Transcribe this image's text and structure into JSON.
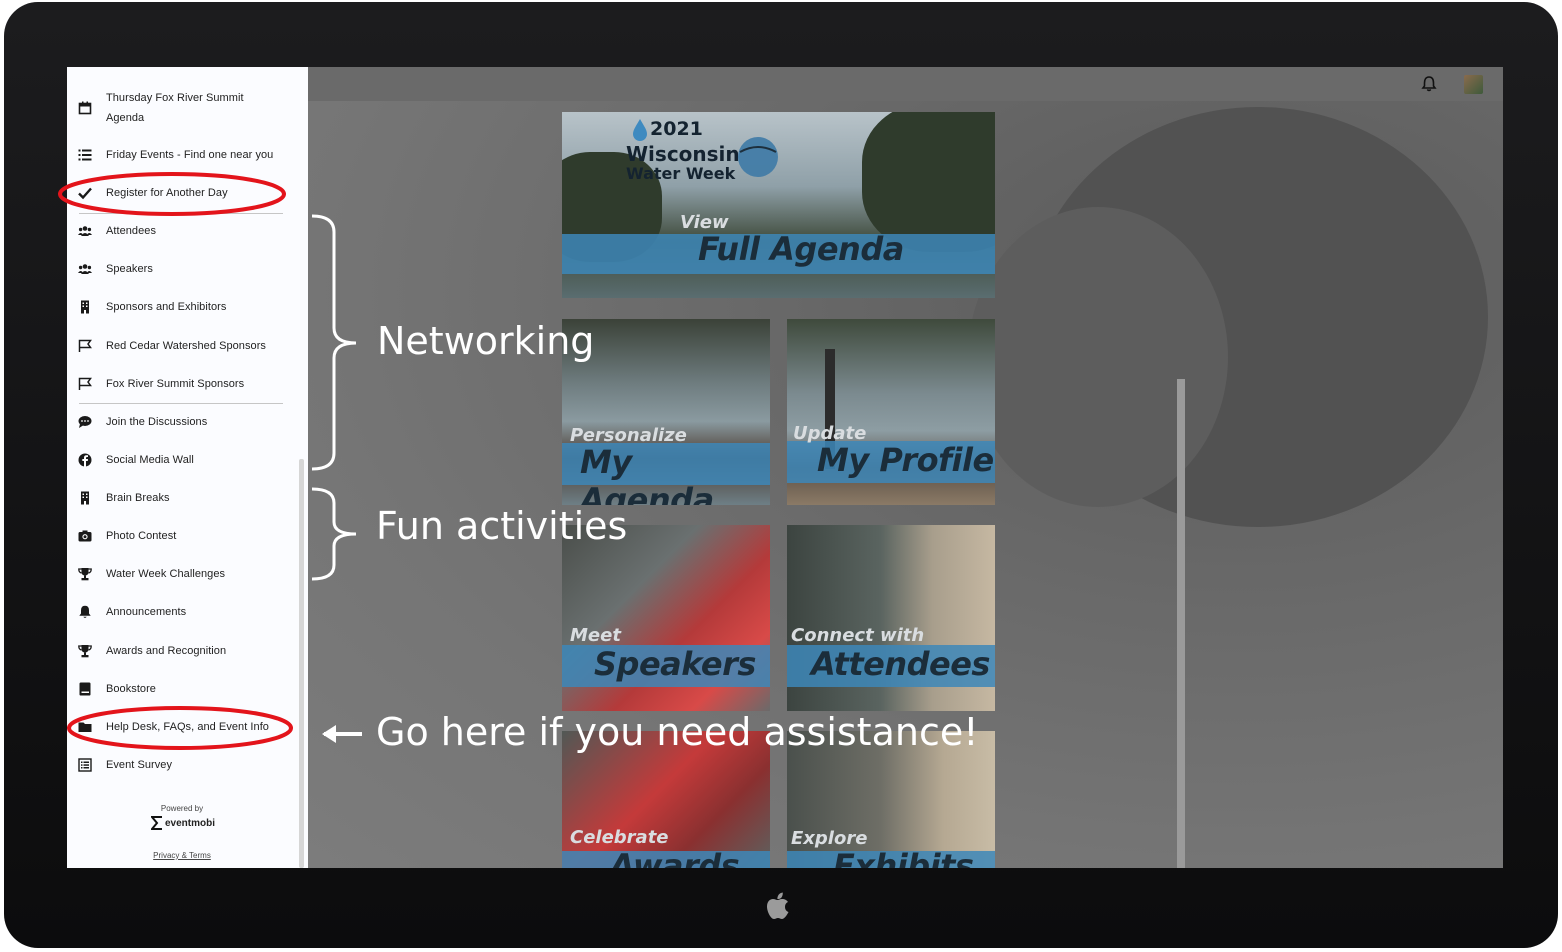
{
  "sidebar": {
    "items": [
      {
        "label": "Thursday Fox River Summit Agenda",
        "icon": "calendar-icon"
      },
      {
        "label": "Friday Events - Find one near you",
        "icon": "list-icon"
      },
      {
        "label": "Register for Another Day",
        "icon": "checkmark-icon"
      },
      {
        "label": "Attendees",
        "icon": "people-icon"
      },
      {
        "label": "Speakers",
        "icon": "people-icon"
      },
      {
        "label": "Sponsors and Exhibitors",
        "icon": "building-icon"
      },
      {
        "label": "Red Cedar Watershed Sponsors",
        "icon": "flag-icon"
      },
      {
        "label": "Fox River Summit Sponsors",
        "icon": "flag-icon"
      },
      {
        "label": "Join the Discussions",
        "icon": "chat-icon"
      },
      {
        "label": "Social Media Wall",
        "icon": "facebook-icon"
      },
      {
        "label": "Brain Breaks",
        "icon": "building-icon"
      },
      {
        "label": "Photo Contest",
        "icon": "camera-icon"
      },
      {
        "label": "Water Week Challenges",
        "icon": "trophy-icon"
      },
      {
        "label": "Announcements",
        "icon": "bell-icon"
      },
      {
        "label": "Awards and Recognition",
        "icon": "trophy-icon"
      },
      {
        "label": "Bookstore",
        "icon": "book-icon"
      },
      {
        "label": "Help Desk, FAQs, and Event Info",
        "icon": "folder-icon"
      },
      {
        "label": "Event Survey",
        "icon": "survey-icon"
      }
    ],
    "powered_by": "Powered by",
    "brand": "eventmobi",
    "privacy": "Privacy & Terms"
  },
  "tiles": {
    "full_agenda": {
      "year": "2021",
      "line1": "Wisconsin",
      "line2": "Water Week",
      "small": "View",
      "big": "Full Agenda"
    },
    "my_agenda": {
      "small": "Personalize",
      "big": "My Agenda"
    },
    "my_profile": {
      "small": "Update",
      "big": "My Profile"
    },
    "speakers": {
      "small": "Meet",
      "big": "Speakers"
    },
    "attendees": {
      "small": "Connect with",
      "big": "Attendees"
    },
    "awards": {
      "small": "Celebrate",
      "big": "Awards"
    },
    "exhibits": {
      "small": "Explore",
      "big": "Exhibits"
    }
  },
  "annotations": {
    "networking": "Networking",
    "fun": "Fun activities",
    "help": "Go here if you need assistance!"
  },
  "colors": {
    "highlight_ellipse": "#e3141b",
    "tile_band": "#3d87b8",
    "annotation_text": "#ffffff"
  }
}
